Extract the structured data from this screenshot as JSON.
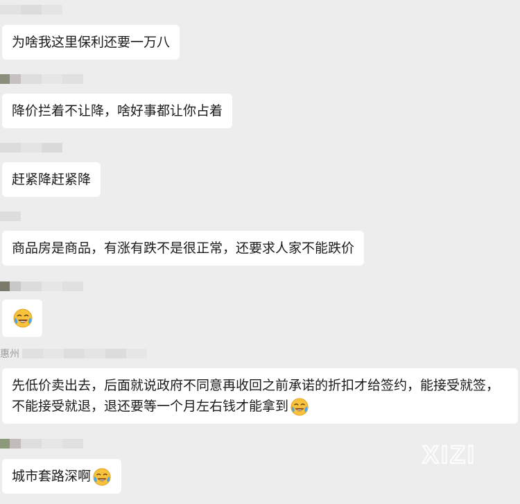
{
  "messages": [
    {
      "sender": "",
      "text": "为啥我这里保利还要一万八",
      "emoji": ""
    },
    {
      "sender": "",
      "text": "降价拦着不让降，啥好事都让你占着",
      "emoji": ""
    },
    {
      "sender": "",
      "text": "赶紧降赶紧降",
      "emoji": ""
    },
    {
      "sender": "",
      "text": "商品房是商品，有涨有跌不是很正常，还要求人家不能跌价",
      "emoji": ""
    },
    {
      "sender": "",
      "text": "",
      "emoji": "crying-laughing-emoji"
    },
    {
      "sender": "惠州",
      "text": "先低价卖出去，后面就说政府不同意再收回之前承诺的折扣才给签约，能接受就签，不能接受就退，退还要等一个月左右钱才能拿到",
      "emoji": "crying-laughing-emoji"
    },
    {
      "sender": "",
      "text": "城市套路深啊",
      "emoji": "crying-laughing-emoji"
    }
  ],
  "watermark": {
    "text": "XIZI"
  },
  "colors": {
    "background": "#ededed",
    "bubble": "#ffffff",
    "text": "#1a1a1a"
  }
}
